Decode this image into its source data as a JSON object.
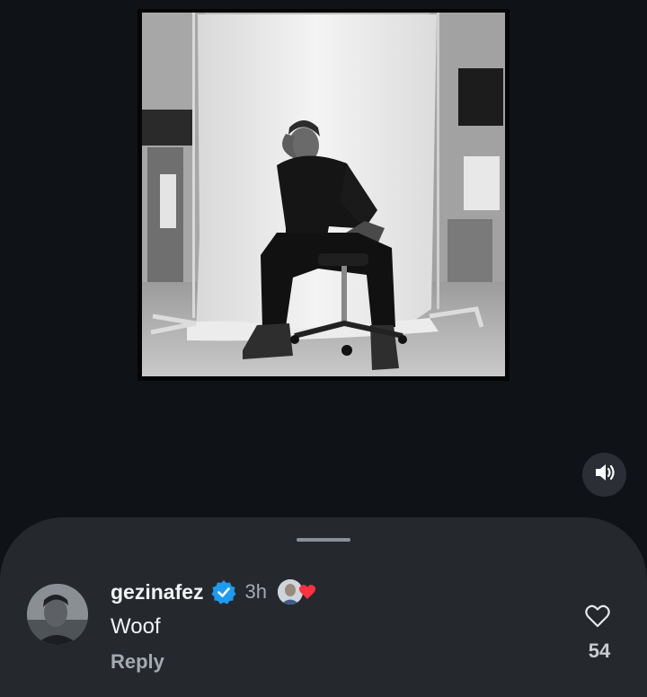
{
  "post": {
    "media_description_icon": "photo",
    "mute_icon": "speaker-icon"
  },
  "comment": {
    "username": "gezinafez",
    "verified_icon": "verified-badge-icon",
    "time": "3h",
    "liked_by_creator_icon": "heart-icon",
    "text": "Woof",
    "reply_label": "Reply",
    "like_count": "54"
  },
  "colors": {
    "background": "#0f1217",
    "sheet": "#25292e",
    "verified": "#1d9bf0",
    "heart": "#ff3040"
  }
}
